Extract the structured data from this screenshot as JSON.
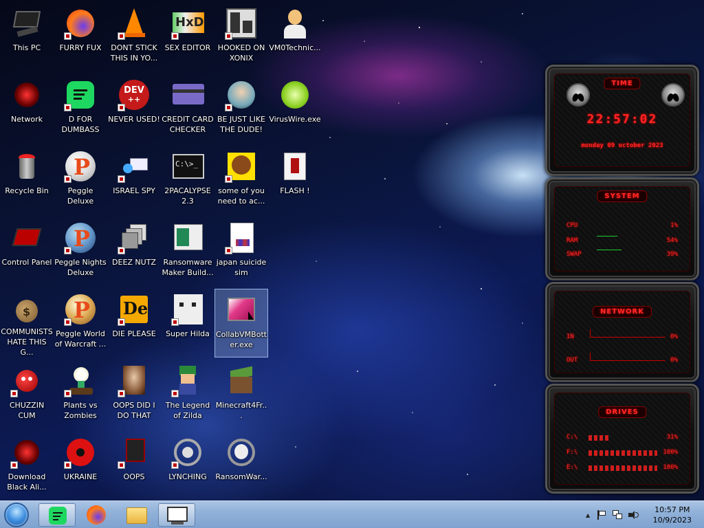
{
  "desktop": {
    "icons": [
      {
        "label": "This PC"
      },
      {
        "label": "FURRY FUX"
      },
      {
        "label": "DONT STICK THIS IN YO..."
      },
      {
        "label": "SEX EDITOR"
      },
      {
        "label": "HOOKED ON XONIX"
      },
      {
        "label": "VM0Technic..."
      },
      {
        "label": "Network"
      },
      {
        "label": "D FOR DUMBASS"
      },
      {
        "label": "NEVER USED!"
      },
      {
        "label": "CREDIT CARD CHECKER"
      },
      {
        "label": "BE JUST LIKE THE DUDE!"
      },
      {
        "label": "VirusWire.exe"
      },
      {
        "label": "Recycle Bin"
      },
      {
        "label": "Peggle Deluxe"
      },
      {
        "label": "ISRAEL SPY"
      },
      {
        "label": "2PACALYPSE 2.3"
      },
      {
        "label": "some of you need to ac..."
      },
      {
        "label": "FLASH !"
      },
      {
        "label": "Control Panel"
      },
      {
        "label": "Peggle Nights Deluxe"
      },
      {
        "label": "DEEZ NUTZ"
      },
      {
        "label": "Ransomware Maker Build..."
      },
      {
        "label": "japan suicide sim"
      },
      {
        "label": "COMMUNISTS HATE THIS G..."
      },
      {
        "label": "Peggle World of Warcraft ..."
      },
      {
        "label": "DIE PLEASE"
      },
      {
        "label": "Super Hilda"
      },
      {
        "label": "CollabVMBott er.exe"
      },
      {
        "label": "CHUZZIN CUM"
      },
      {
        "label": "Plants vs Zombies"
      },
      {
        "label": "OOPS DID I DO THAT"
      },
      {
        "label": "The Legend of Zilda"
      },
      {
        "label": "Minecraft4Fr..."
      },
      {
        "label": "Download Black Ali..."
      },
      {
        "label": "UKRAINE"
      },
      {
        "label": "OOPS"
      },
      {
        "label": "LYNCHING"
      },
      {
        "label": "RansomWar..."
      }
    ],
    "icon_badges": {
      "dev": "DEV",
      "dev_plus": "++",
      "de": "De",
      "cmd": "C:\\>_"
    }
  },
  "gadgets": {
    "time": {
      "title": "TIME",
      "clock": "22:57:02",
      "date": "monday 09 october 2023"
    },
    "system": {
      "title": "SYSTEM",
      "cpu_label": "CPU",
      "cpu_value": "1%",
      "ram_label": "RAM",
      "ram_value": "54%",
      "swap_label": "SWAP",
      "swap_value": "39%"
    },
    "network": {
      "title": "NETWORK",
      "in_label": "IN",
      "in_value": "0%",
      "out_label": "OUT",
      "out_value": "0%"
    },
    "drives": {
      "title": "DRIVES",
      "items": [
        {
          "label": "C:\\",
          "value": "31%"
        },
        {
          "label": "F:\\",
          "value": "100%"
        },
        {
          "label": "E:\\",
          "value": "100%"
        }
      ]
    }
  },
  "taskbar": {
    "clock_time": "10:57 PM",
    "clock_date": "10/9/2023",
    "tray_chevron": "▲",
    "colors": {
      "taskbar": "#8fb0d8",
      "gadget_red": "#ff2424",
      "selection": "#96b4e6"
    }
  }
}
